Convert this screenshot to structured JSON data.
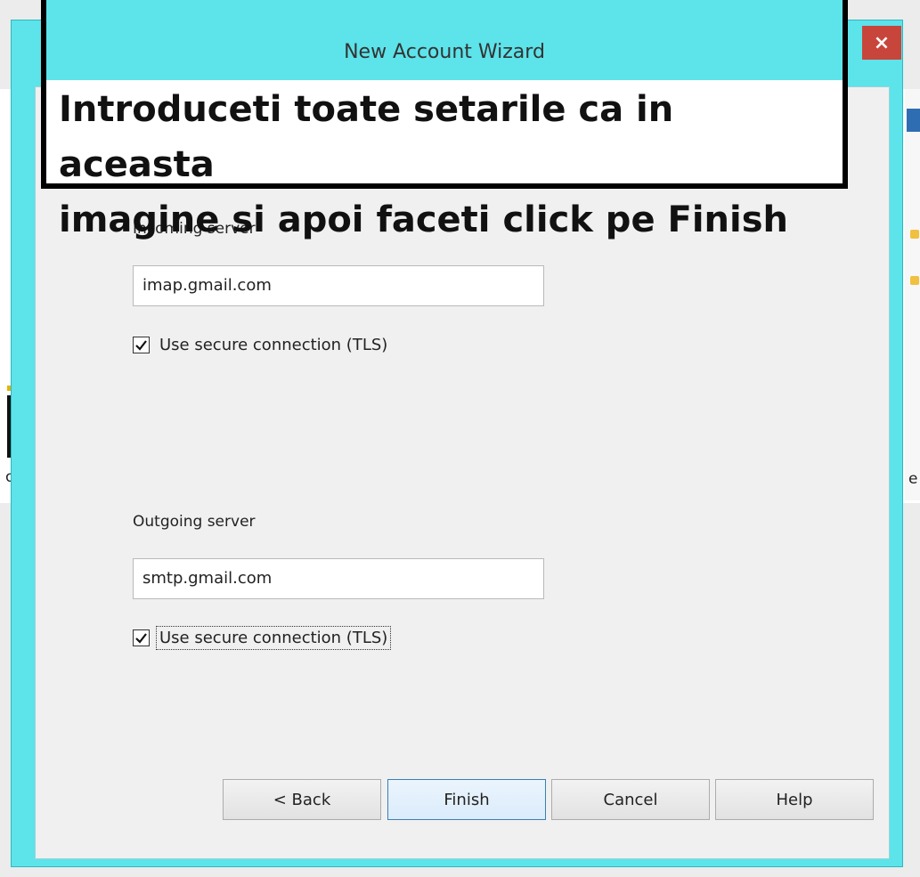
{
  "dialog": {
    "title": "New Account Wizard",
    "close_glyph": "×"
  },
  "annotation": {
    "line1": "Introduceti toate setarile ca in aceasta",
    "line2": "imagine si apoi faceti click pe Finish"
  },
  "incoming": {
    "label": "Incoming server",
    "value": "imap.gmail.com",
    "tls_label": "Use secure connection (TLS)",
    "tls_checked": true
  },
  "outgoing": {
    "label": "Outgoing server",
    "value": "smtp.gmail.com",
    "tls_label": "Use secure connection (TLS)",
    "tls_checked": true
  },
  "buttons": {
    "back": "< Back",
    "finish": "Finish",
    "cancel": "Cancel",
    "help": "Help"
  },
  "colors": {
    "frame": "#5de3ea",
    "close": "#c8453b",
    "primary_border": "#3c7fb1"
  }
}
